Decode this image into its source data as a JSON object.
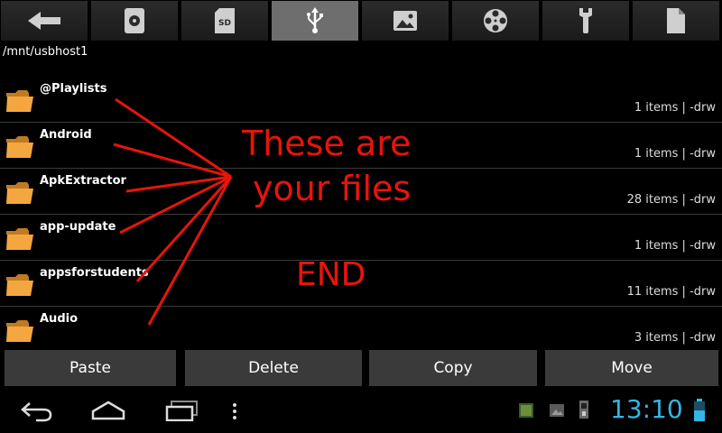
{
  "toolbar": {
    "tabs": [
      {
        "icon": "back-arrow-icon"
      },
      {
        "icon": "internal-storage-icon"
      },
      {
        "icon": "sd-card-icon",
        "label": "SD"
      },
      {
        "icon": "usb-icon",
        "active": true
      },
      {
        "icon": "image-icon"
      },
      {
        "icon": "film-reel-icon"
      },
      {
        "icon": "wrench-icon"
      },
      {
        "icon": "document-icon"
      }
    ]
  },
  "current_path": "/mnt/usbhost1",
  "files": [
    {
      "name": "@Playlists",
      "meta": "1 items | -drw"
    },
    {
      "name": "Android",
      "meta": "1 items | -drw"
    },
    {
      "name": "ApkExtractor",
      "meta": "28 items | -drw"
    },
    {
      "name": "app-update",
      "meta": "1 items | -drw"
    },
    {
      "name": "appsforstudents",
      "meta": "11 items | -drw"
    },
    {
      "name": "Audio",
      "meta": "3 items | -drw"
    }
  ],
  "annotation": {
    "line1": "These are",
    "line2": "your files",
    "end": "END",
    "color": "#e8140a"
  },
  "actions": {
    "paste": "Paste",
    "delete": "Delete",
    "copy": "Copy",
    "move": "Move"
  },
  "status": {
    "time": "13:10",
    "accent": "#33b5e5"
  }
}
